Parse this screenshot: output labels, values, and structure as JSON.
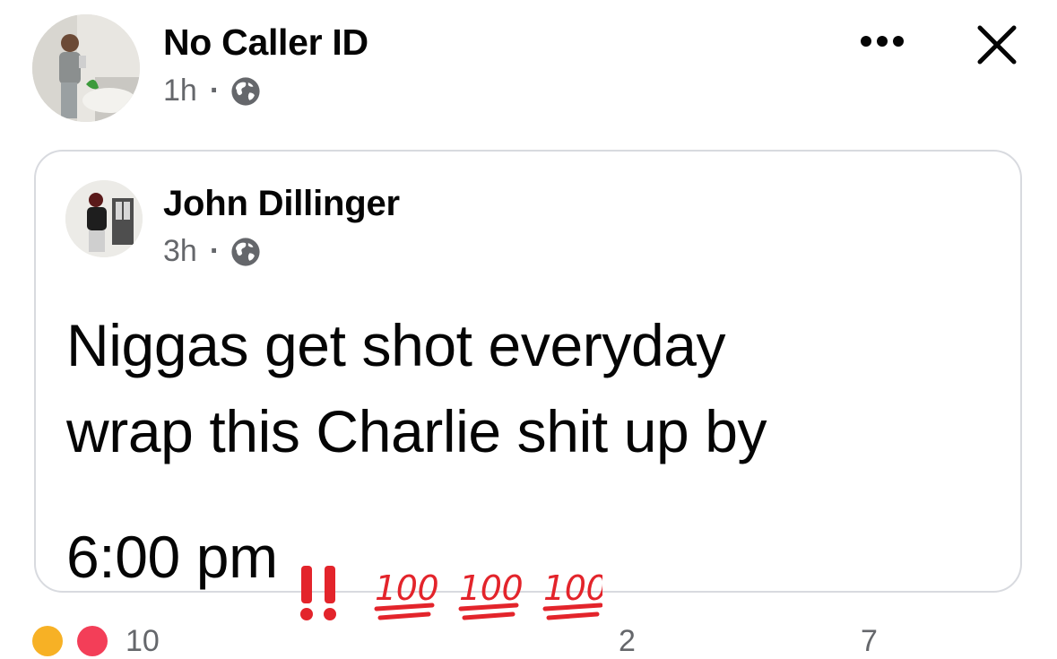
{
  "post": {
    "author_name": "No Caller ID",
    "time": "1h",
    "separator": "·",
    "privacy_icon": "globe-icon",
    "actions": {
      "more_icon": "more-horizontal-icon",
      "close_icon": "close-icon"
    }
  },
  "shared_post": {
    "author_name": "John Dillinger",
    "time": "3h",
    "separator": "·",
    "privacy_icon": "globe-icon",
    "text": "Niggas get shot everyday\nwrap this Charlie shit up by\n6:00 pm",
    "emojis": "‼️💯💯💯"
  },
  "reactions_bar": {
    "reaction_icons": [
      "laugh-reaction-icon",
      "love-reaction-icon"
    ],
    "reaction_count": "10",
    "comments": "2",
    "shares": "7"
  },
  "colors": {
    "text_primary": "#050505",
    "text_secondary": "#65676b",
    "card_border": "#d8dadf",
    "love": "#f33e58",
    "laugh": "#f7b125",
    "exclamation": "#e3242b",
    "hundred": "#e3242b"
  }
}
